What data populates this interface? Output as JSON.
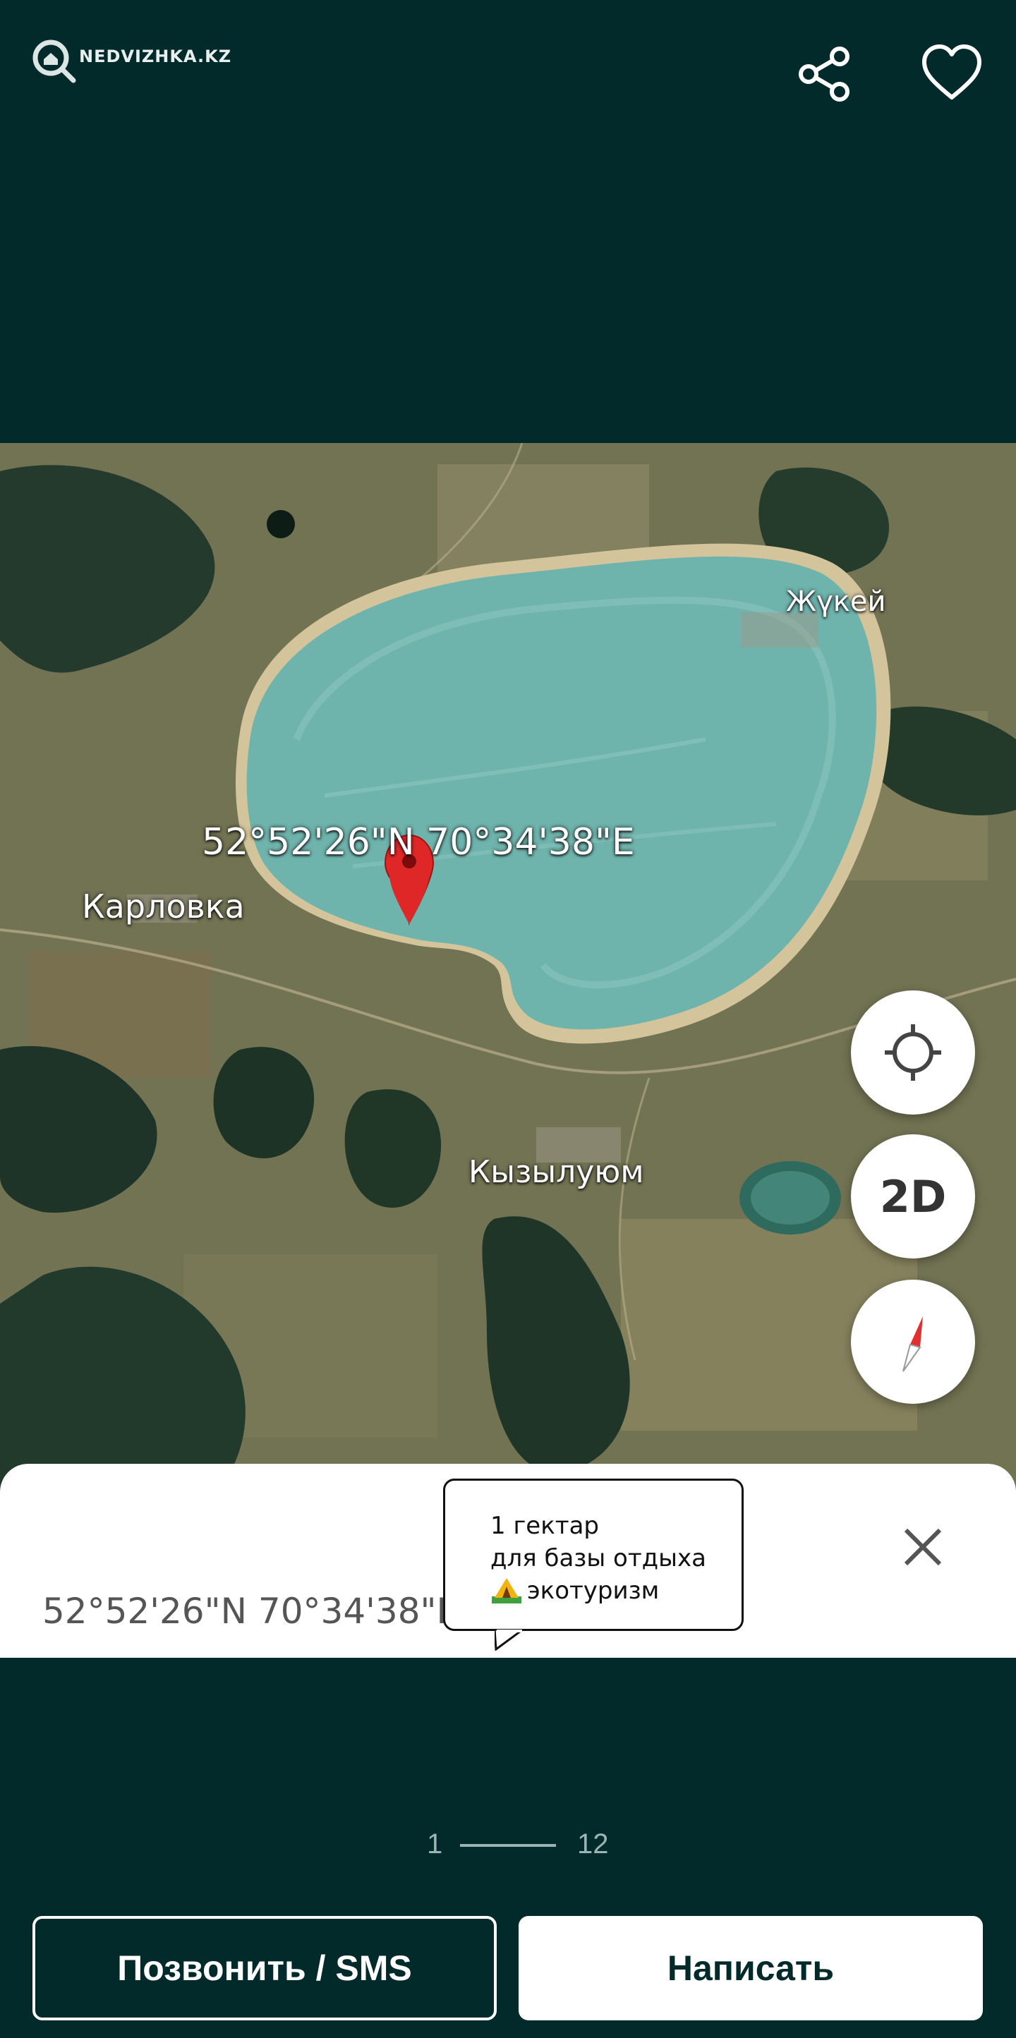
{
  "header": {
    "logo_text": "NEDVIZHKA.KZ",
    "back_icon": "chevron-left-icon",
    "share_icon": "share-icon",
    "favorite_icon": "heart-icon"
  },
  "photo": {
    "coords_label": "52°52'26\"N 70°34'38\"E",
    "place_labels": {
      "village_west": "Карловка",
      "village_ne": "Жүкей",
      "village_south": "Кызылуюм"
    },
    "map_controls": {
      "locate_icon": "crosshair-icon",
      "view_mode_label": "2D",
      "compass_icon": "compass-icon"
    },
    "bottom_sheet": {
      "coords_text": "52°52'26\"N 70°34'38\"E •",
      "close_icon": "close-icon"
    },
    "tooltip": {
      "line1": "1 гектар",
      "line2": "для базы отдыха",
      "line3": "экотуризм",
      "line3_icon": "camping-tent-icon"
    }
  },
  "pager": {
    "current": "1",
    "total": "12"
  },
  "actions": {
    "call_label": "Позвонить / SMS",
    "write_label": "Написать"
  },
  "colors": {
    "background": "#032a2b",
    "lake": "#6fb3ad",
    "marker": "#e02727",
    "write_button_bg": "#ffffff"
  }
}
